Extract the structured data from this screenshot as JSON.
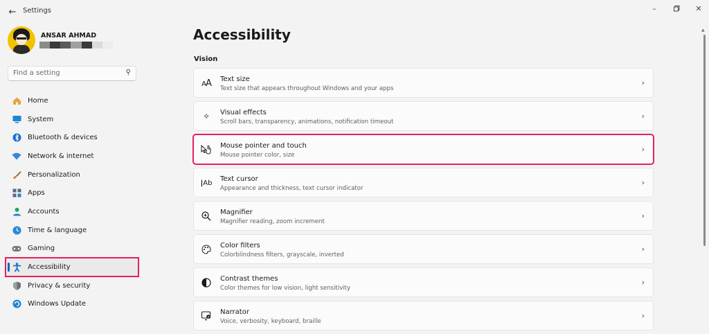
{
  "window": {
    "title": "Settings",
    "back_icon": "back-arrow-icon",
    "controls": [
      "minimize-icon",
      "maximize-icon",
      "close-icon"
    ]
  },
  "profile": {
    "name": "ANSAR AHMAD",
    "email_redacted_colors": [
      "#8a8a8a",
      "#3a3a3a",
      "#5a5a5a",
      "#a0a0a0",
      "#3a3a3a",
      "#dcdcdc",
      "#ececec"
    ]
  },
  "search": {
    "placeholder": "Find a setting",
    "icon": "search-icon"
  },
  "sidebar": {
    "items": [
      {
        "label": "Home",
        "icon": "home-icon",
        "color": "#e8a33d",
        "active": false
      },
      {
        "label": "System",
        "icon": "system-icon",
        "color": "#1b86d6",
        "active": false
      },
      {
        "label": "Bluetooth & devices",
        "icon": "bluetooth-icon",
        "color": "#1b6fd6",
        "active": false
      },
      {
        "label": "Network & internet",
        "icon": "wifi-icon",
        "color": "#3a87d8",
        "active": false
      },
      {
        "label": "Personalization",
        "icon": "brush-icon",
        "color": "#d8772a",
        "active": false
      },
      {
        "label": "Apps",
        "icon": "apps-icon",
        "color": "#5a6a80",
        "active": false
      },
      {
        "label": "Accounts",
        "icon": "accounts-icon",
        "color": "#2aa56a",
        "active": false
      },
      {
        "label": "Time & language",
        "icon": "globe-clock-icon",
        "color": "#2a88d8",
        "active": false
      },
      {
        "label": "Gaming",
        "icon": "gamepad-icon",
        "color": "#6a6a6a",
        "active": false
      },
      {
        "label": "Accessibility",
        "icon": "accessibility-icon",
        "color": "#1a6fd0",
        "active": true
      },
      {
        "label": "Privacy & security",
        "icon": "shield-icon",
        "color": "#6a7078",
        "active": false
      },
      {
        "label": "Windows Update",
        "icon": "update-icon",
        "color": "#1b86d6",
        "active": false
      }
    ]
  },
  "main": {
    "title": "Accessibility",
    "section": "Vision",
    "cards": [
      {
        "title": "Text size",
        "subtitle": "Text size that appears throughout Windows and your apps",
        "icon": "text-size-icon",
        "highlight": false
      },
      {
        "title": "Visual effects",
        "subtitle": "Scroll bars, transparency, animations, notification timeout",
        "icon": "visual-effects-icon",
        "highlight": false
      },
      {
        "title": "Mouse pointer and touch",
        "subtitle": "Mouse pointer color, size",
        "icon": "mouse-pointer-icon",
        "highlight": true
      },
      {
        "title": "Text cursor",
        "subtitle": "Appearance and thickness, text cursor indicator",
        "icon": "text-cursor-icon",
        "highlight": false
      },
      {
        "title": "Magnifier",
        "subtitle": "Magnifier reading, zoom increment",
        "icon": "magnifier-icon",
        "highlight": false
      },
      {
        "title": "Color filters",
        "subtitle": "Colorblindness filters, grayscale, inverted",
        "icon": "color-filters-icon",
        "highlight": false
      },
      {
        "title": "Contrast themes",
        "subtitle": "Color themes for low vision, light sensitivity",
        "icon": "contrast-icon",
        "highlight": false
      },
      {
        "title": "Narrator",
        "subtitle": "Voice, verbosity, keyboard, braille",
        "icon": "narrator-icon",
        "highlight": false
      }
    ]
  },
  "colors": {
    "highlight": "#e61f5c",
    "accent": "#0067c0"
  }
}
